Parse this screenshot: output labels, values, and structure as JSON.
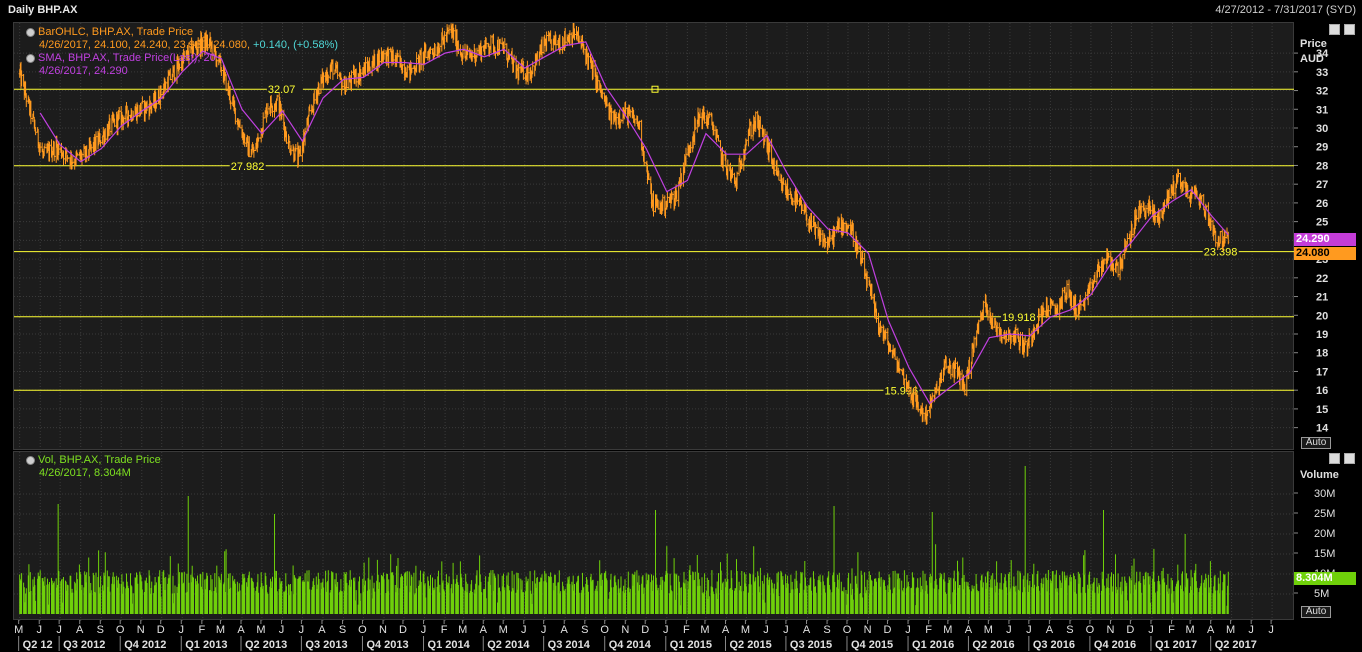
{
  "window": {
    "title": "Daily BHP.AX",
    "date_range": "4/27/2012 - 7/31/2017 (SYD)"
  },
  "price_panel": {
    "legend": [
      {
        "icon": "ohlc-icon",
        "text": "BarOHLC, BHP.AX, Trade Price",
        "color": "#ff9a1f"
      },
      {
        "icon": "",
        "text": "4/26/2017, 24.100, 24.240, 23.930, 24.080, ",
        "change": "+0.140, (+0.58%)",
        "color": "#ff9a1f",
        "change_color": "#4fd8d8"
      },
      {
        "icon": "sma-icon",
        "text": "SMA, BHP.AX, Trade Price(Last), 20",
        "color": "#c040e0"
      },
      {
        "icon": "",
        "text": "4/26/2017, 24.290",
        "color": "#c040e0"
      }
    ],
    "axis_title": "Price",
    "axis_unit": "AUD",
    "last_sma_label": "24.290",
    "last_price_label": "24.080",
    "auto_label": "Auto"
  },
  "volume_panel": {
    "legend": [
      {
        "icon": "vol-icon",
        "text": "Vol, BHP.AX, Trade Price",
        "color": "#7ee021"
      },
      {
        "icon": "",
        "text": "4/26/2017, 8.304M",
        "color": "#7ee021"
      }
    ],
    "axis_title": "Volume",
    "last_volume_label": "8.304M",
    "auto_label": "Auto"
  },
  "chart_data": [
    {
      "type": "line",
      "title": "Daily BHP.AX",
      "ylabel": "Price AUD",
      "ylim": [
        13.5,
        35.5
      ],
      "y_ticks": [
        14,
        15,
        16,
        17,
        18,
        19,
        20,
        21,
        22,
        23,
        24,
        25,
        26,
        27,
        28,
        29,
        30,
        31,
        32,
        33,
        34
      ],
      "x_range": [
        "2012-04-27",
        "2017-07-31"
      ],
      "grid": true,
      "series": [
        {
          "name": "BarOHLC, BHP.AX, Trade Price",
          "color": "#ff9a1f",
          "points": [
            [
              "2012-05-01",
              32.9
            ],
            [
              "2012-05-20",
              30.5
            ],
            [
              "2012-06-05",
              28.5
            ],
            [
              "2012-06-25",
              29.0
            ],
            [
              "2012-07-20",
              28.3
            ],
            [
              "2012-08-10",
              28.6
            ],
            [
              "2012-09-01",
              29.5
            ],
            [
              "2012-09-20",
              30.3
            ],
            [
              "2012-10-10",
              30.7
            ],
            [
              "2012-11-01",
              31.0
            ],
            [
              "2012-11-20",
              31.3
            ],
            [
              "2012-12-10",
              32.5
            ],
            [
              "2013-01-01",
              33.6
            ],
            [
              "2013-01-20",
              34.3
            ],
            [
              "2013-02-10",
              34.6
            ],
            [
              "2013-03-01",
              33.2
            ],
            [
              "2013-03-20",
              31.0
            ],
            [
              "2013-04-10",
              28.9
            ],
            [
              "2013-04-20",
              28.7
            ],
            [
              "2013-05-10",
              31.2
            ],
            [
              "2013-05-25",
              31.4
            ],
            [
              "2013-06-10",
              29.2
            ],
            [
              "2013-06-25",
              28.3
            ],
            [
              "2013-07-10",
              30.4
            ],
            [
              "2013-07-25",
              32.2
            ],
            [
              "2013-08-15",
              33.3
            ],
            [
              "2013-09-01",
              32.2
            ],
            [
              "2013-09-20",
              32.8
            ],
            [
              "2013-10-10",
              33.3
            ],
            [
              "2013-11-01",
              34.0
            ],
            [
              "2013-11-20",
              33.6
            ],
            [
              "2013-12-10",
              33.0
            ],
            [
              "2014-01-01",
              33.9
            ],
            [
              "2014-01-20",
              34.3
            ],
            [
              "2014-02-10",
              35.2
            ],
            [
              "2014-03-01",
              33.8
            ],
            [
              "2014-03-20",
              34.0
            ],
            [
              "2014-04-10",
              34.5
            ],
            [
              "2014-05-01",
              34.2
            ],
            [
              "2014-05-20",
              33.0
            ],
            [
              "2014-06-10",
              33.0
            ],
            [
              "2014-07-01",
              34.5
            ],
            [
              "2014-07-25",
              34.6
            ],
            [
              "2014-08-15",
              35.1
            ],
            [
              "2014-09-01",
              34.0
            ],
            [
              "2014-09-20",
              32.2
            ],
            [
              "2014-10-10",
              30.5
            ],
            [
              "2014-11-01",
              30.8
            ],
            [
              "2014-11-20",
              30.2
            ],
            [
              "2014-12-10",
              26.0
            ],
            [
              "2014-12-25",
              25.8
            ],
            [
              "2015-01-15",
              26.4
            ],
            [
              "2015-02-05",
              29.2
            ],
            [
              "2015-02-20",
              30.7
            ],
            [
              "2015-03-10",
              30.3
            ],
            [
              "2015-03-25",
              28.4
            ],
            [
              "2015-04-15",
              27.0
            ],
            [
              "2015-05-01",
              29.5
            ],
            [
              "2015-05-15",
              30.4
            ],
            [
              "2015-06-01",
              29.1
            ],
            [
              "2015-06-20",
              27.0
            ],
            [
              "2015-07-10",
              26.3
            ],
            [
              "2015-07-25",
              25.6
            ],
            [
              "2015-08-15",
              24.3
            ],
            [
              "2015-09-01",
              23.8
            ],
            [
              "2015-09-20",
              24.9
            ],
            [
              "2015-10-05",
              24.7
            ],
            [
              "2015-10-15",
              23.6
            ],
            [
              "2015-11-01",
              21.5
            ],
            [
              "2015-11-15",
              19.6
            ],
            [
              "2015-12-01",
              18.4
            ],
            [
              "2015-12-20",
              17.0
            ],
            [
              "2016-01-10",
              15.4
            ],
            [
              "2016-01-25",
              14.6
            ],
            [
              "2016-02-10",
              15.8
            ],
            [
              "2016-02-25",
              17.3
            ],
            [
              "2016-03-10",
              17.1
            ],
            [
              "2016-03-25",
              16.2
            ],
            [
              "2016-04-10",
              18.8
            ],
            [
              "2016-04-25",
              20.7
            ],
            [
              "2016-05-10",
              19.3
            ],
            [
              "2016-05-25",
              19.0
            ],
            [
              "2016-06-10",
              18.9
            ],
            [
              "2016-06-25",
              18.2
            ],
            [
              "2016-07-10",
              19.6
            ],
            [
              "2016-07-25",
              20.4
            ],
            [
              "2016-08-10",
              20.3
            ],
            [
              "2016-08-25",
              21.3
            ],
            [
              "2016-09-10",
              20.3
            ],
            [
              "2016-09-25",
              20.8
            ],
            [
              "2016-10-10",
              22.3
            ],
            [
              "2016-10-25",
              23.0
            ],
            [
              "2016-11-10",
              22.5
            ],
            [
              "2016-11-25",
              23.7
            ],
            [
              "2016-12-10",
              25.5
            ],
            [
              "2016-12-25",
              25.8
            ],
            [
              "2017-01-10",
              25.1
            ],
            [
              "2017-01-25",
              26.3
            ],
            [
              "2017-02-10",
              27.4
            ],
            [
              "2017-02-25",
              26.4
            ],
            [
              "2017-03-10",
              26.5
            ],
            [
              "2017-03-25",
              25.4
            ],
            [
              "2017-04-10",
              24.0
            ],
            [
              "2017-04-26",
              24.08
            ]
          ]
        },
        {
          "name": "SMA, BHP.AX, Trade Price(Last), 20",
          "color": "#c040e0",
          "points": [
            [
              "2012-06-01",
              30.8
            ],
            [
              "2012-07-01",
              29.1
            ],
            [
              "2012-08-01",
              28.2
            ],
            [
              "2012-09-01",
              28.9
            ],
            [
              "2012-10-01",
              30.1
            ],
            [
              "2012-11-01",
              30.9
            ],
            [
              "2012-12-01",
              31.6
            ],
            [
              "2013-01-01",
              33.0
            ],
            [
              "2013-02-01",
              34.1
            ],
            [
              "2013-03-01",
              33.7
            ],
            [
              "2013-04-01",
              31.0
            ],
            [
              "2013-05-01",
              29.7
            ],
            [
              "2013-06-01",
              30.9
            ],
            [
              "2013-07-01",
              29.3
            ],
            [
              "2013-08-01",
              31.6
            ],
            [
              "2013-09-01",
              32.6
            ],
            [
              "2013-10-01",
              32.7
            ],
            [
              "2013-11-01",
              33.5
            ],
            [
              "2013-12-01",
              33.5
            ],
            [
              "2014-01-01",
              33.4
            ],
            [
              "2014-02-01",
              34.0
            ],
            [
              "2014-03-01",
              34.2
            ],
            [
              "2014-04-01",
              33.8
            ],
            [
              "2014-05-01",
              34.2
            ],
            [
              "2014-06-01",
              33.2
            ],
            [
              "2014-07-01",
              33.8
            ],
            [
              "2014-08-01",
              34.4
            ],
            [
              "2014-09-01",
              34.6
            ],
            [
              "2014-10-01",
              32.2
            ],
            [
              "2014-11-01",
              30.6
            ],
            [
              "2014-12-01",
              28.9
            ],
            [
              "2015-01-01",
              26.6
            ],
            [
              "2015-02-01",
              27.2
            ],
            [
              "2015-03-01",
              29.7
            ],
            [
              "2015-04-01",
              28.6
            ],
            [
              "2015-05-01",
              28.6
            ],
            [
              "2015-06-01",
              29.6
            ],
            [
              "2015-07-01",
              27.6
            ],
            [
              "2015-08-01",
              25.8
            ],
            [
              "2015-09-01",
              24.6
            ],
            [
              "2015-10-01",
              24.4
            ],
            [
              "2015-11-01",
              23.3
            ],
            [
              "2015-12-01",
              19.7
            ],
            [
              "2016-01-01",
              17.2
            ],
            [
              "2016-02-01",
              15.3
            ],
            [
              "2016-03-01",
              16.1
            ],
            [
              "2016-04-01",
              16.9
            ],
            [
              "2016-05-01",
              18.8
            ],
            [
              "2016-06-01",
              19.0
            ],
            [
              "2016-07-01",
              18.9
            ],
            [
              "2016-08-01",
              19.9
            ],
            [
              "2016-09-01",
              20.3
            ],
            [
              "2016-10-01",
              21.1
            ],
            [
              "2016-11-01",
              22.8
            ],
            [
              "2016-12-01",
              23.9
            ],
            [
              "2017-01-01",
              25.3
            ],
            [
              "2017-02-01",
              26.1
            ],
            [
              "2017-03-01",
              26.7
            ],
            [
              "2017-04-01",
              25.3
            ],
            [
              "2017-04-26",
              24.29
            ]
          ]
        }
      ],
      "horizontal_lines": [
        {
          "y": 32.07,
          "label": "32.07",
          "label_date": "2013-05-10"
        },
        {
          "y": 27.982,
          "label": "27.982",
          "label_date": "2013-03-15"
        },
        {
          "y": 23.398,
          "label": "23.398",
          "label_date": "2017-03-20"
        },
        {
          "y": 19.918,
          "label": "19.918",
          "label_date": "2016-05-20"
        },
        {
          "y": 15.996,
          "label": "15.996",
          "label_date": "2015-11-25"
        }
      ]
    },
    {
      "type": "bar",
      "title": "Vol, BHP.AX, Trade Price",
      "ylabel": "Volume",
      "ylim": [
        0,
        33
      ],
      "y_ticks": [
        5,
        10,
        15,
        20,
        25,
        30
      ],
      "y_tick_labels": [
        "5M",
        "10M",
        "15M",
        "20M",
        "25M",
        "30M"
      ],
      "x_range": [
        "2012-04-27",
        "2017-07-31"
      ],
      "typical_range_millions": [
        5,
        11
      ],
      "spikes": [
        {
          "date": "2013-01-10",
          "value": 29.5
        },
        {
          "date": "2012-06-28",
          "value": 27.5
        },
        {
          "date": "2013-05-20",
          "value": 25.0
        },
        {
          "date": "2014-12-15",
          "value": 26.0
        },
        {
          "date": "2015-09-10",
          "value": 27.0
        },
        {
          "date": "2016-02-05",
          "value": 25.5
        },
        {
          "date": "2016-06-24",
          "value": 37.0
        },
        {
          "date": "2016-10-20",
          "value": 26.0
        },
        {
          "date": "2017-02-20",
          "value": 20.0
        }
      ],
      "last": {
        "date": "2017-04-26",
        "value": 8.304
      }
    }
  ],
  "x_axis": {
    "months": [
      "M",
      "J",
      "J",
      "A",
      "S",
      "O",
      "N",
      "D",
      "J",
      "F",
      "M",
      "A",
      "M",
      "J",
      "J",
      "A",
      "S",
      "O",
      "N",
      "D",
      "J",
      "F",
      "M",
      "A",
      "M",
      "J",
      "J",
      "A",
      "S",
      "O",
      "N",
      "D",
      "J",
      "F",
      "M",
      "A",
      "M",
      "J",
      "J",
      "A",
      "S",
      "O",
      "N",
      "D",
      "J",
      "F",
      "M",
      "A",
      "M",
      "J",
      "J",
      "A",
      "S",
      "O",
      "N",
      "D",
      "J",
      "F",
      "M",
      "A",
      "M",
      "J",
      "J",
      "A",
      "S",
      "O",
      "N",
      "D",
      "J",
      "F",
      "M",
      "A",
      "M",
      "J",
      "J"
    ],
    "quarters": [
      "Q2 12",
      "Q3 2012",
      "Q4 2012",
      "Q1 2013",
      "Q2 2013",
      "Q3 2013",
      "Q4 2013",
      "Q1 2014",
      "Q2 2014",
      "Q3 2014",
      "Q4 2014",
      "Q1 2015",
      "Q2 2015",
      "Q3 2015",
      "Q4 2015",
      "Q1 2016",
      "Q2 2016",
      "Q3 2016",
      "Q4 2016",
      "Q1 2017",
      "Q2 2017"
    ]
  },
  "colors": {
    "price": "#ff9a1f",
    "sma": "#c040e0",
    "volume": "#6fd00a",
    "hline": "#ffff33",
    "grid": "#3a3a3a",
    "panel_bg": "#1c1c1c"
  }
}
